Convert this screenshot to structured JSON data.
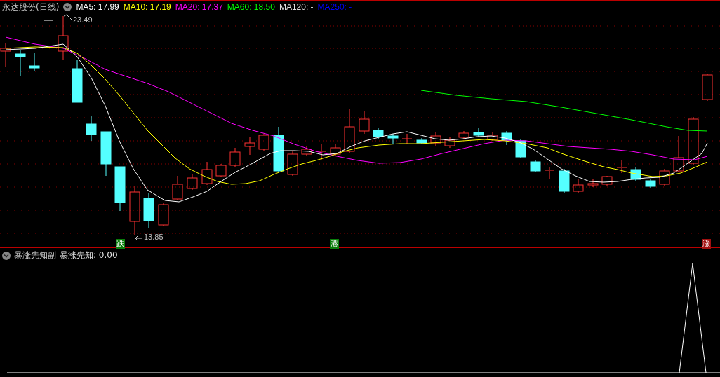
{
  "title": "永达股份(日线)",
  "ma": [
    {
      "label": "MA5: 17.99",
      "color": "#ffffff"
    },
    {
      "label": "MA10: 17.19",
      "color": "#ffff00"
    },
    {
      "label": "MA20: 17.37",
      "color": "#ff00ff"
    },
    {
      "label": "MA60: 18.50",
      "color": "#00ff00"
    },
    {
      "label": "MA120: -",
      "color": "#e0e0e0"
    },
    {
      "label": "MA250: -",
      "color": "#0000ff"
    }
  ],
  "high_label": "23.49",
  "low_label": "13.85",
  "signals": [
    {
      "text": "跌",
      "kind": "down"
    },
    {
      "text": "港",
      "kind": "port"
    },
    {
      "text": "涨",
      "kind": "up"
    }
  ],
  "indicator": {
    "name": "暴涨先知副",
    "value": "暴涨先知: 0.00"
  }
}
